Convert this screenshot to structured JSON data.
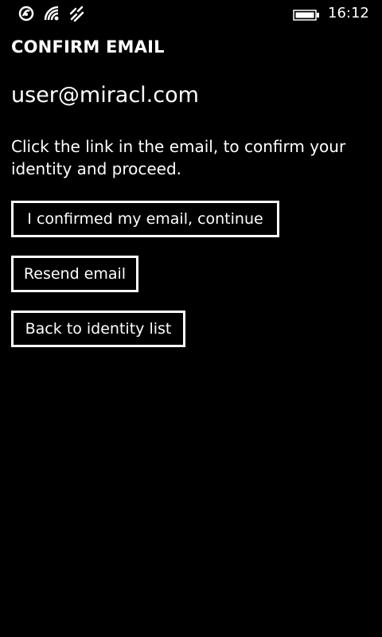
{
  "status_bar": {
    "time": "16:12",
    "icons": [
      "nfc-icon",
      "wifi-icon",
      "signal-icon",
      "battery-icon"
    ]
  },
  "page": {
    "title": "CONFIRM EMAIL",
    "email": "user@miracl.com",
    "instructions": "Click the link in the email, to confirm your identity and proceed."
  },
  "actions": {
    "continue_label": "I confirmed my email, continue",
    "resend_label": "Resend email",
    "back_label": "Back to identity list"
  },
  "colors": {
    "background": "#000000",
    "foreground": "#ffffff"
  }
}
